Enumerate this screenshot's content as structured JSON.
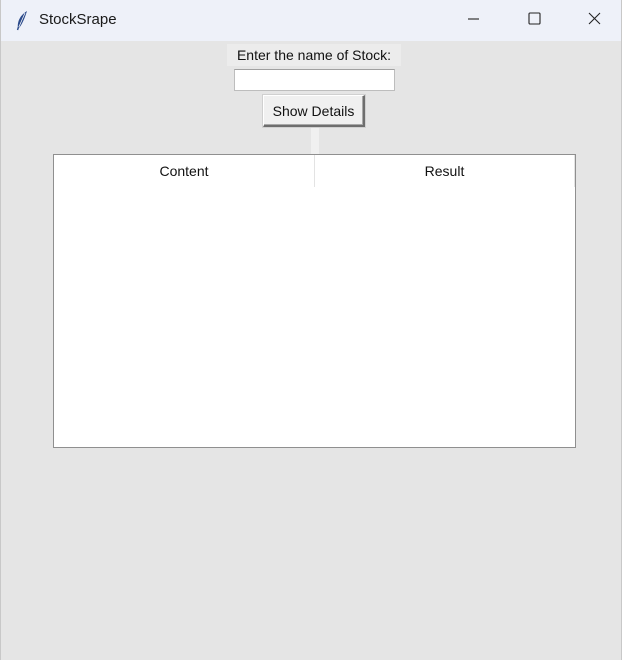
{
  "window": {
    "title": "StockSrape",
    "icon": "feather-icon",
    "controls": [
      "minimize-icon",
      "maximize-icon",
      "close-icon"
    ]
  },
  "form": {
    "label": "Enter the name of Stock:",
    "input_value": "",
    "input_placeholder": "",
    "button_label": "Show Details"
  },
  "table": {
    "columns": [
      "Content",
      "Result"
    ],
    "rows": []
  }
}
